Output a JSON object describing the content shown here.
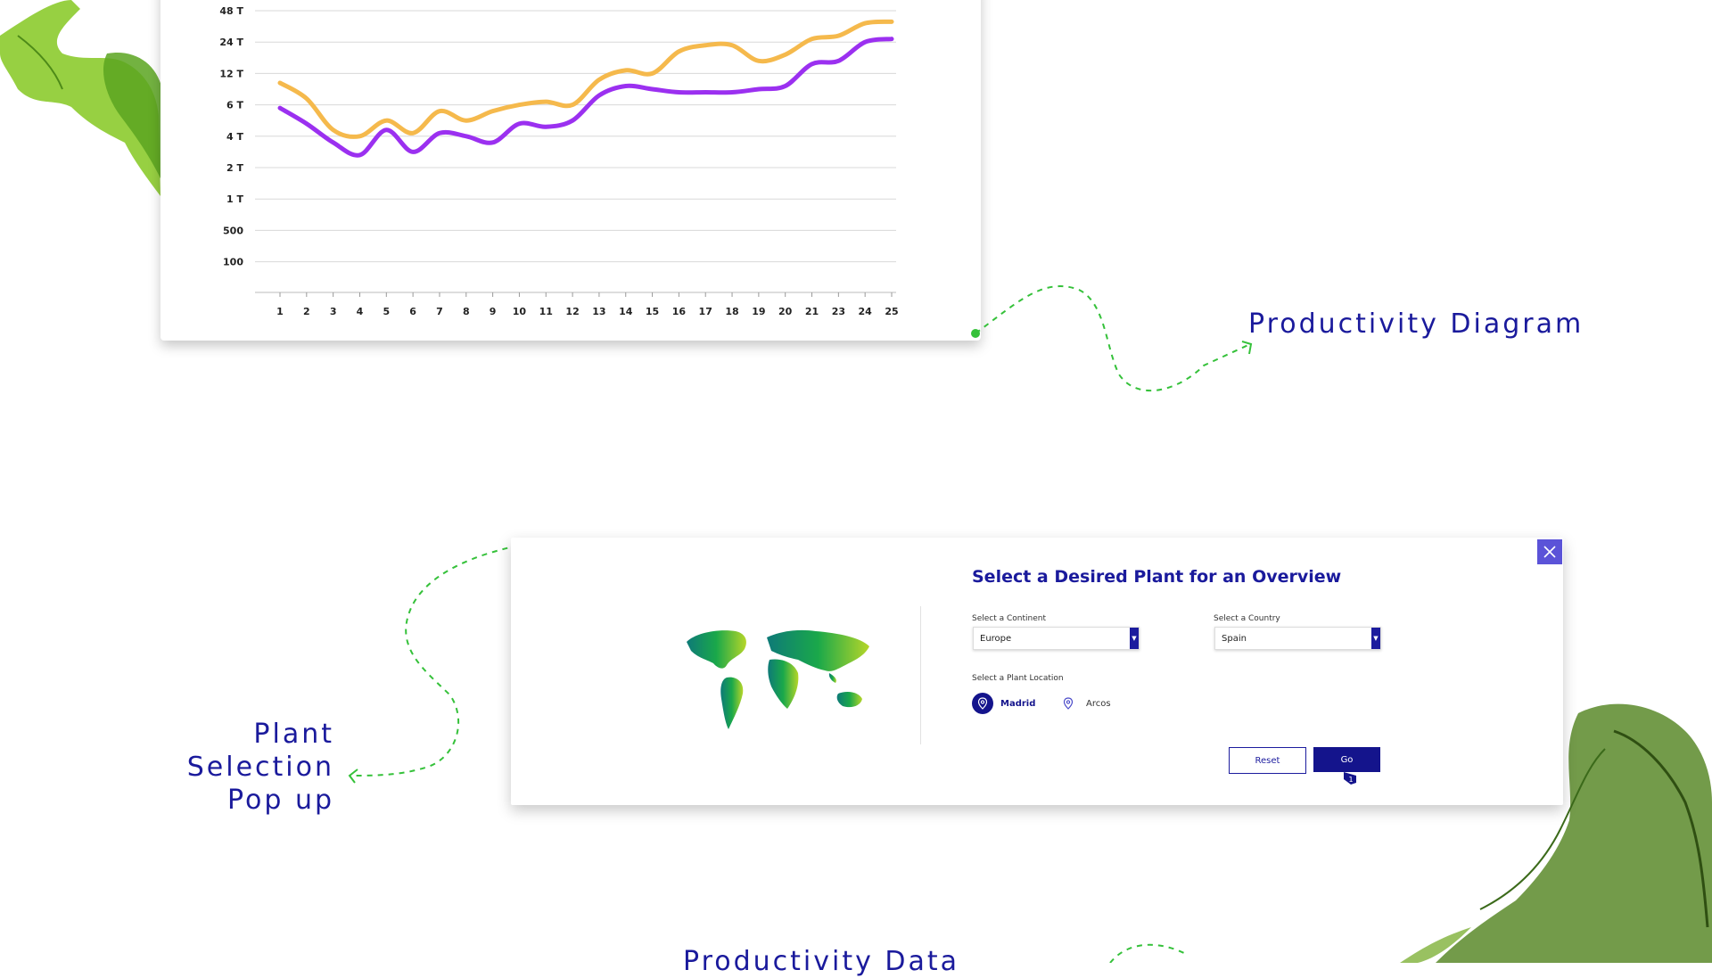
{
  "chart_data": {
    "type": "line",
    "x": [
      1,
      2,
      3,
      4,
      5,
      6,
      7,
      8,
      9,
      10,
      11,
      12,
      13,
      14,
      15,
      16,
      17,
      18,
      19,
      20,
      21,
      23,
      24,
      25
    ],
    "y_tick_labels": [
      "48 T",
      "24 T",
      "12 T",
      "6 T",
      "4 T",
      "2 T",
      "1 T",
      "500",
      "100"
    ],
    "series": [
      {
        "color": "#f5b94c",
        "values_in_tick_index": [
          2.3,
          2.8,
          3.8,
          4.0,
          3.5,
          3.9,
          3.2,
          3.5,
          3.2,
          3.0,
          2.9,
          3.0,
          2.2,
          1.9,
          2.0,
          1.3,
          1.1,
          1.1,
          1.6,
          1.4,
          0.9,
          0.8,
          0.4,
          0.35
        ]
      },
      {
        "color": "#9b30f0",
        "values_in_tick_index": [
          3.1,
          3.6,
          4.2,
          4.6,
          3.8,
          4.5,
          3.9,
          4.0,
          4.2,
          3.6,
          3.7,
          3.5,
          2.7,
          2.4,
          2.5,
          2.6,
          2.6,
          2.6,
          2.5,
          2.4,
          1.7,
          1.6,
          1.0,
          0.9
        ]
      }
    ]
  },
  "labels": {
    "productivity_diagram": "Productivity Diagram",
    "plant_line1": "Plant",
    "plant_line2": "Selection",
    "plant_line3": "Pop up",
    "productivity_data": "Productivity Data"
  },
  "popup": {
    "title": "Select a Desired Plant for an Overview",
    "continent_label": "Select a Continent",
    "continent_value": "Europe",
    "country_label": "Select a Country",
    "country_value": "Spain",
    "location_label": "Select a Plant Location",
    "locations": [
      "Madrid",
      "Arcos"
    ],
    "reset_label": "Reset",
    "go_label": "Go",
    "badge": "1"
  },
  "colors": {
    "brand_blue": "#1a1a9c",
    "close_bg": "#5b53d8",
    "dash_green": "#35c13a",
    "series1": "#f5b94c",
    "series2": "#9b30f0"
  }
}
